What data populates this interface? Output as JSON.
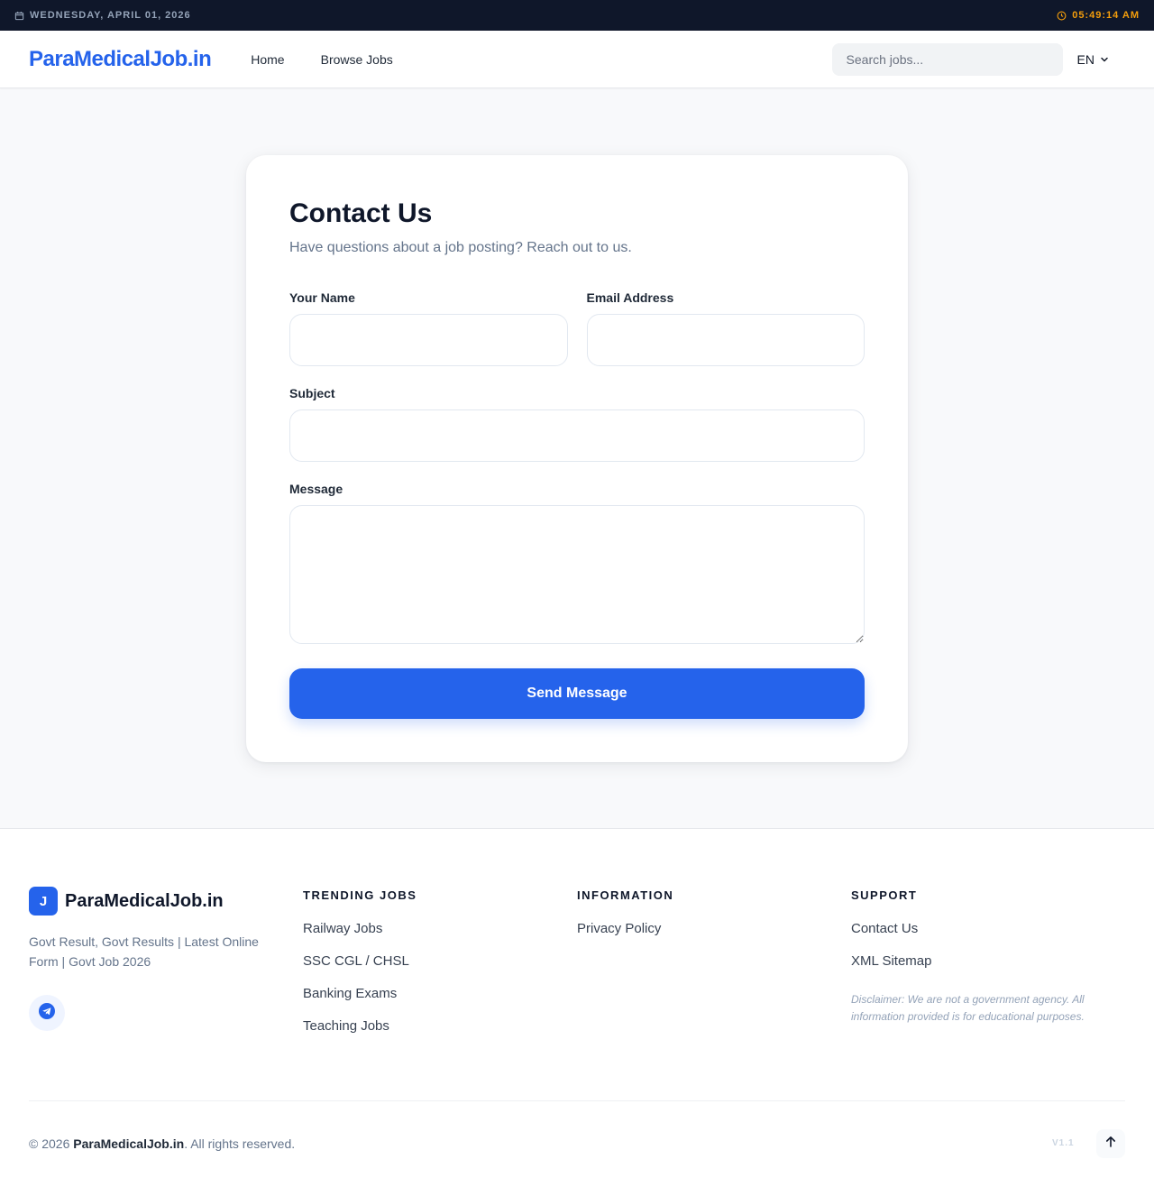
{
  "topbar": {
    "date": "WEDNESDAY, APRIL 01, 2026",
    "time": "05:49:14 AM",
    "date_icon": "calendar-icon",
    "time_icon": "clock-icon"
  },
  "header": {
    "logo": "ParaMedicalJob.in",
    "nav": [
      {
        "label": "Home"
      },
      {
        "label": "Browse Jobs"
      }
    ],
    "search_placeholder": "Search jobs...",
    "language": "EN"
  },
  "contact": {
    "title": "Contact Us",
    "subtitle": "Have questions about a job posting? Reach out to us.",
    "name_label": "Your Name",
    "name_value": "",
    "email_label": "Email Address",
    "email_value": "",
    "subject_label": "Subject",
    "subject_value": "",
    "message_label": "Message",
    "message_value": "",
    "submit_label": "Send Message"
  },
  "footer": {
    "badge": "J",
    "brand": "ParaMedicalJob.in",
    "description": "Govt Result, Govt Results | Latest Online Form | Govt Job 2026",
    "social_icon": "telegram-icon",
    "columns": [
      {
        "heading": "TRENDING JOBS",
        "links": [
          "Railway Jobs",
          "SSC CGL / CHSL",
          "Banking Exams",
          "Teaching Jobs"
        ]
      },
      {
        "heading": "INFORMATION",
        "links": [
          "Privacy Policy"
        ]
      },
      {
        "heading": "SUPPORT",
        "links": [
          "Contact Us",
          "XML Sitemap"
        ]
      }
    ],
    "disclaimer": "Disclaimer: We are not a government agency. All information provided is for educational purposes.",
    "copyright_prefix": "© 2026 ",
    "copyright_brand": "ParaMedicalJob.in",
    "copyright_suffix": ". All rights reserved.",
    "version": "V1.1"
  },
  "colors": {
    "accent": "#2563eb",
    "topbar_bg": "#0f172a",
    "time_color": "#f59e0b"
  }
}
